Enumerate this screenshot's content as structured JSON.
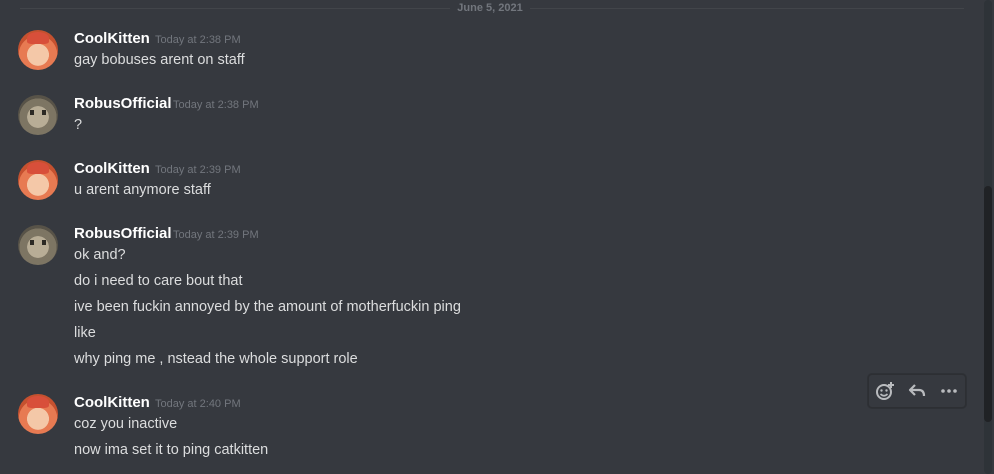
{
  "divider": {
    "date": "June 5, 2021"
  },
  "messages": [
    {
      "author": "CoolKitten",
      "timestamp": "Today at 2:38 PM",
      "lines": [
        "gay bobuses arent on staff"
      ]
    },
    {
      "author": "RobusOfficial",
      "timestamp": "Today at 2:38 PM",
      "lines": [
        "?"
      ]
    },
    {
      "author": "CoolKitten",
      "timestamp": "Today at 2:39 PM",
      "lines": [
        "u arent anymore staff"
      ]
    },
    {
      "author": "RobusOfficial",
      "timestamp": "Today at 2:39 PM",
      "lines": [
        "ok and?",
        "do i need to care bout that",
        "ive been fuckin annoyed by the amount of motherfuckin ping",
        "like",
        "why ping me , nstead the whole support role"
      ]
    },
    {
      "author": "CoolKitten",
      "timestamp": "Today at 2:40 PM",
      "lines": [
        "coz you inactive",
        "now ima set it to ping catkitten"
      ]
    }
  ],
  "toolbar": {
    "icons": [
      "add-reaction-icon",
      "reply-icon",
      "more-icon"
    ]
  },
  "colors": {
    "background": "#36393f",
    "username": "#ffffff",
    "message_text": "#dcddde",
    "timestamp": "#72767d"
  }
}
